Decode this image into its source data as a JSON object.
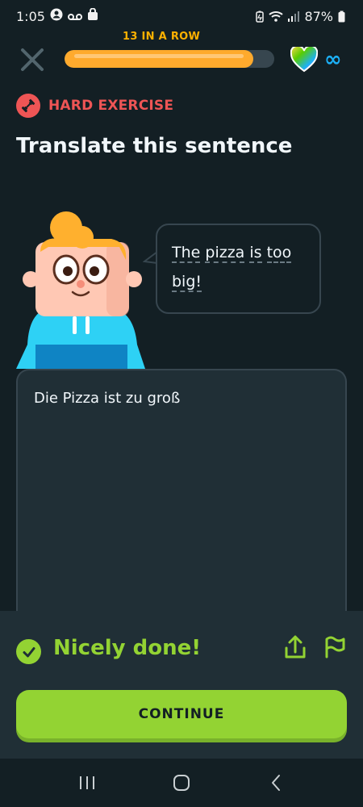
{
  "status_bar": {
    "time": "1:05",
    "battery": "87%",
    "icons": [
      "profile-icon",
      "voicemail-icon",
      "bag-icon",
      "battery-saver-icon",
      "wifi-icon",
      "signal-icon",
      "battery-icon"
    ]
  },
  "top_bar": {
    "streak_label": "13 IN A ROW",
    "progress": 0.9,
    "hearts": "∞",
    "colors": {
      "progress": "#ffaa2d",
      "track": "#37464f",
      "infinity": "#1cb0f6"
    }
  },
  "exercise": {
    "badge_label": "HARD EXERCISE",
    "title": "Translate this sentence",
    "prompt_words": [
      "The",
      "pizza",
      "is",
      "too",
      "big!"
    ],
    "answer": "Die Pizza ist zu groß"
  },
  "feedback": {
    "message": "Nicely done!",
    "continue_label": "CONTINUE",
    "colors": {
      "success": "#93d333",
      "badge_hard": "#ee5555"
    }
  },
  "nav": {
    "items": [
      "recent-apps-icon",
      "home-icon",
      "back-icon"
    ]
  }
}
